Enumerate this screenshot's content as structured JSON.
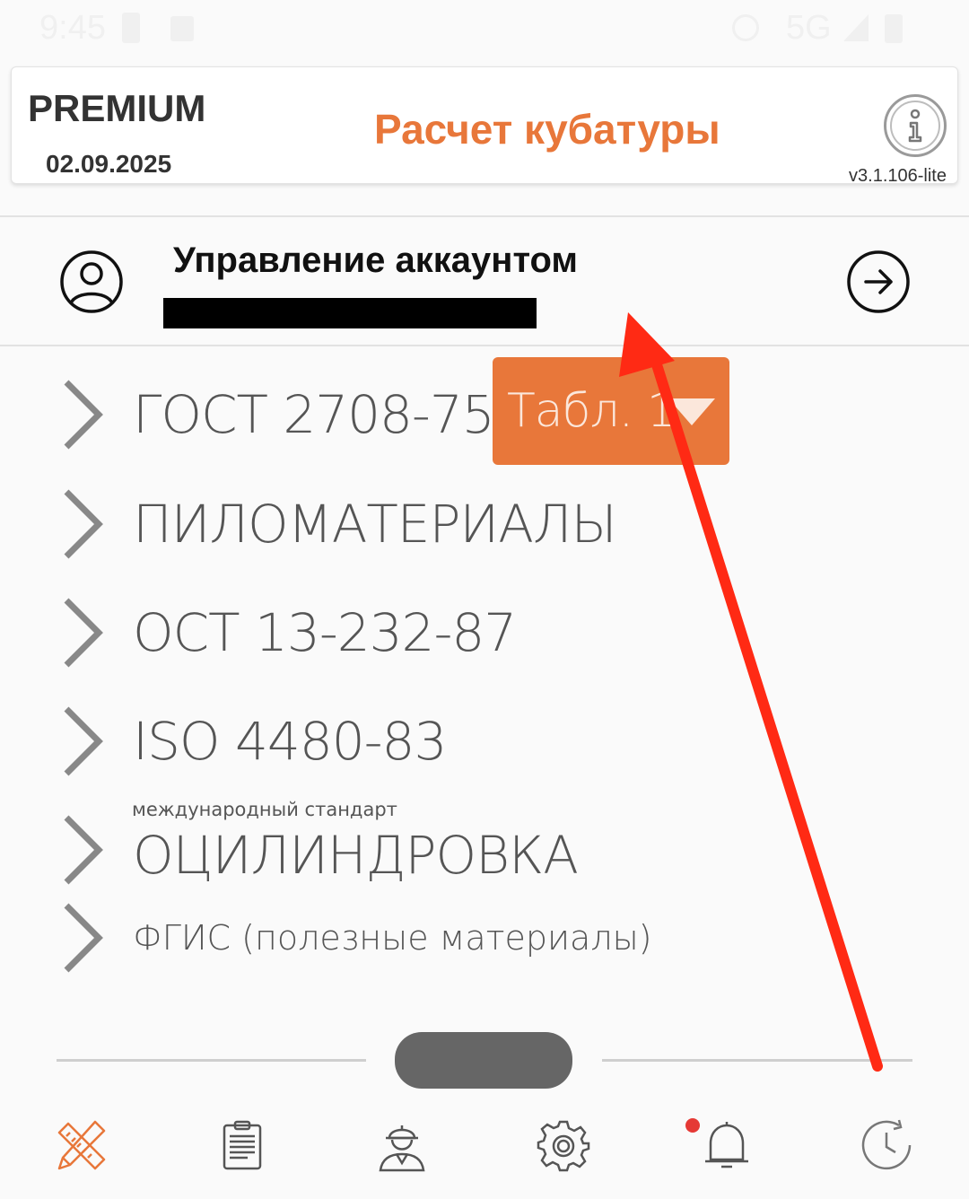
{
  "header": {
    "tier": "PREMIUM",
    "expiry_date": "02.09.2025",
    "title": "Расчет кубатуры",
    "version": "v3.1.106-lite",
    "info_icon": "info-icon",
    "title_color": "#e8773a"
  },
  "account": {
    "title": "Управление аккаунтом",
    "avatar_icon": "user-circle-icon",
    "arrow_icon": "arrow-right-circle-icon"
  },
  "menu": {
    "items": [
      {
        "label": "ГОСТ 2708-75"
      },
      {
        "label": "ПИЛОМАТЕРИАЛЫ"
      },
      {
        "label": "ОСТ 13-232-87"
      },
      {
        "label": "ISO 4480-83"
      },
      {
        "label": "ОЦИЛИНДРОВКА",
        "caption": "международный стандарт"
      },
      {
        "label": "ФГИС (полезные материалы)"
      }
    ],
    "table_select": {
      "value": "Табл. 1"
    }
  },
  "bottom_nav": {
    "icons": [
      "ruler-pencil-icon",
      "clipboard-icon",
      "worker-icon",
      "gear-icon",
      "bell-icon",
      "history-icon"
    ],
    "active_color": "#e8773a"
  }
}
